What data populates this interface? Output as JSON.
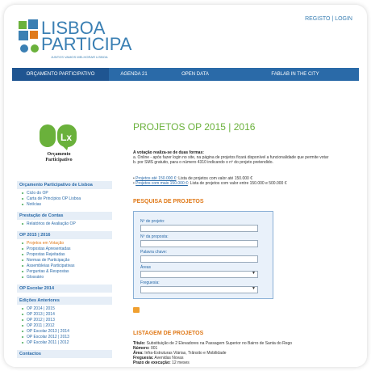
{
  "header": {
    "logo_line1": "LISBOA",
    "logo_line2": "PARTICIPA",
    "logo_tagline": "JUNTOS VAMOS MELHORAR LISBOA",
    "registo": "REGISTO",
    "separator": "|",
    "login": "LOGIN"
  },
  "nav": [
    {
      "label": "ORÇAMENTO PARTICIPATIVO",
      "active": true
    },
    {
      "label": "AGENDA 21",
      "active": false
    },
    {
      "label": "OPEN DATA",
      "active": false
    },
    {
      "label": "FABLAB IN THE CITY",
      "active": false
    }
  ],
  "op_logo": {
    "mark": "Lx",
    "caption1": "Orçamento",
    "caption2": "Participativo"
  },
  "sidebar": [
    {
      "title": "Orçamento Participativo de Lisboa",
      "items": [
        "Ciclo do OP",
        "Carta de Princípios OP Lisboa",
        "Notícias"
      ]
    },
    {
      "title": "Prestação de Contas",
      "items": [
        "Relatórios de Avaliação OP"
      ]
    },
    {
      "title": "OP 2015 | 2016",
      "items": [
        "Projetos em Votação",
        "Propostas Apresentadas",
        "Propostas Rejeitadas",
        "Normas de Participação",
        "Assembleias Participativas",
        "Perguntas & Respostas",
        "Glossário"
      ]
    },
    {
      "title": "OP Escolar 2014",
      "items": []
    },
    {
      "title": "Edições Anteriores",
      "items": [
        "OP 2014 | 2015",
        "OP 2013 | 2014",
        "OP 2012 | 2013",
        "OP 2011 | 2012",
        "OP Escolar 2013 | 2014",
        "OP Escolar 2012 | 2013",
        "OP Escolar 2011 | 2012"
      ]
    },
    {
      "title": "Contactos",
      "items": []
    }
  ],
  "main": {
    "title": "PROJETOS OP 2015 | 2016",
    "intro_bold": "A votação realiza-se de duas formas:",
    "intro_a": "a. Online - após fazer login no site, na página de projetos ficará disponível a funcionalidade que permite votar",
    "intro_b": "b. por SMS gratuito, para o número 4310 indicando o nº do projeto pretendido.",
    "link1": "Projetos até 150.000 €",
    "link1_rest": ": Lista de projetos com valor até 150.000 €",
    "link2": "Projetos com mais 150.000 €",
    "link2_rest": ": Lista de projetos com valor entre 150.000 e 500.000 €",
    "search_title": "PESQUISA DE PROJETOS",
    "field_num": "Nº de projeto:",
    "field_prop": "Nº da proposta:",
    "field_kw": "Palavra chave:",
    "field_area": "Áreas",
    "field_freg": "Freguesia:",
    "listing_title": "LISTAGEM DE PROJETOS",
    "project": {
      "title_label": "Título:",
      "title_value": "Substituição de 2 Elevadores na Passagem Superior no Bairro de Santa do Rego",
      "num_label": "Número:",
      "num_value": "001",
      "area_label": "Área:",
      "area_value": "Infra-Estruturas Viárias, Trânsito e Mobilidade",
      "freg_label": "Freguesia:",
      "freg_value": "Avenidas Novas",
      "prazo_label": "Prazo de execução:",
      "prazo_value": "12 meses"
    }
  },
  "colors": {
    "blue": "#2a6aa8",
    "green": "#6ab13b",
    "orange": "#e07a1a"
  }
}
